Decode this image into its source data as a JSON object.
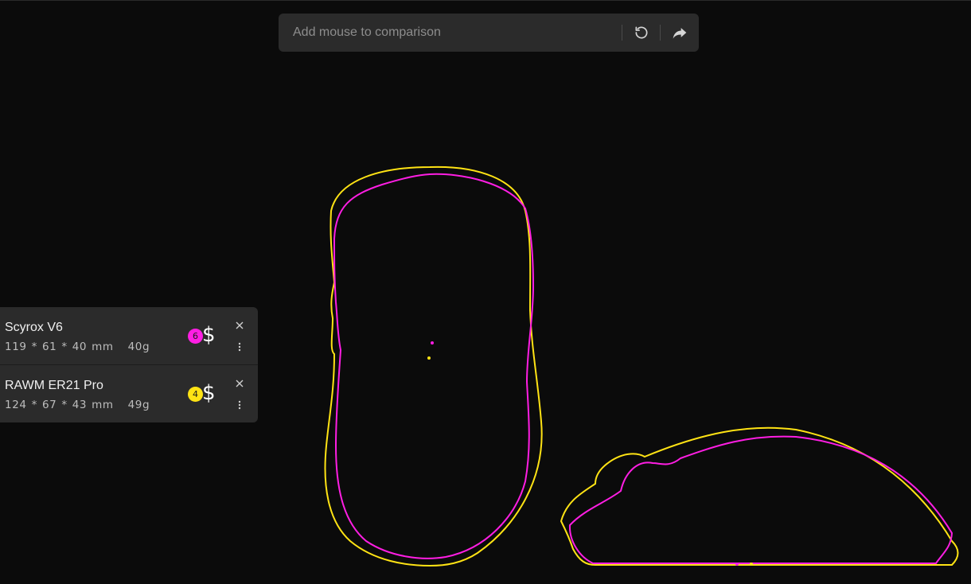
{
  "search": {
    "placeholder": "Add mouse to comparison",
    "reset_icon": "reset-icon",
    "share_icon": "share-icon"
  },
  "mice": [
    {
      "name": "Scyrox V6",
      "length": "119",
      "width": "61",
      "height": "40",
      "unit": "mm",
      "weight": "40g",
      "price_badge": "6",
      "price_symbol": "$",
      "color": "#ff1ee3"
    },
    {
      "name": "RAWM ER21 Pro",
      "length": "124",
      "width": "67",
      "height": "43",
      "unit": "mm",
      "weight": "49g",
      "price_badge": "4",
      "price_symbol": "$",
      "color": "#ffe314"
    }
  ],
  "colors": {
    "background": "#0b0b0b",
    "panel": "#2b2b2b",
    "mouse_a": "#ff1ee3",
    "mouse_b": "#ffe314"
  }
}
